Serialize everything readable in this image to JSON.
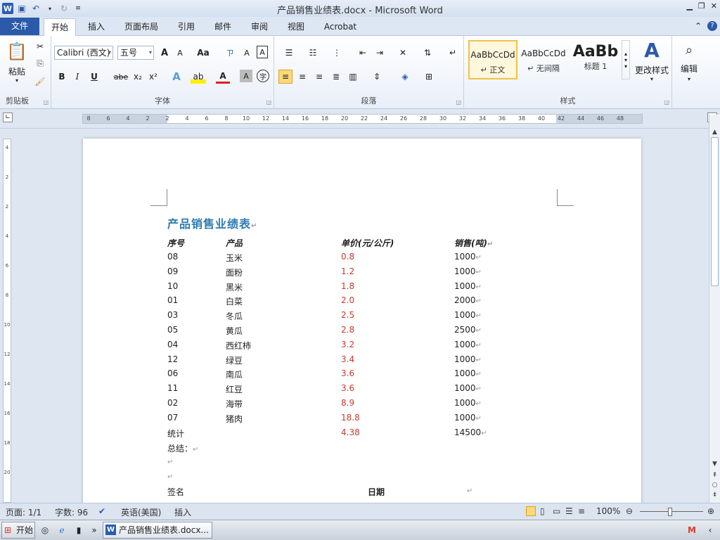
{
  "window": {
    "title": "产品销售业绩表.docx - Microsoft Word"
  },
  "tabs": [
    "文件",
    "开始",
    "插入",
    "页面布局",
    "引用",
    "邮件",
    "审阅",
    "视图",
    "Acrobat"
  ],
  "ribbon": {
    "clipboard": {
      "paste_label": "粘贴",
      "group_label": "剪贴板"
    },
    "font": {
      "font_name": "Calibri (西文)",
      "font_size": "五号",
      "group_label": "字体",
      "bold": "B",
      "italic": "I",
      "underline": "U",
      "strike": "abe",
      "sub": "x₂",
      "sup": "x²",
      "grow": "A",
      "shrink": "A",
      "case": "Aa",
      "clear_format": "A",
      "char_border": "A"
    },
    "paragraph": {
      "group_label": "段落"
    },
    "styles": {
      "group_label": "样式",
      "items": [
        {
          "preview": "AaBbCcDd",
          "name": "↵ 正文"
        },
        {
          "preview": "AaBbCcDd",
          "name": "↵ 无间隔"
        },
        {
          "preview": "AaBb",
          "name": "标题 1"
        }
      ],
      "change_styles": "更改样式"
    },
    "editing": {
      "label": "编辑"
    }
  },
  "ruler": {
    "ticks": [
      "8",
      "6",
      "4",
      "2",
      "2",
      "4",
      "6",
      "8",
      "10",
      "12",
      "14",
      "16",
      "18",
      "20",
      "22",
      "24",
      "26",
      "28",
      "30",
      "32",
      "34",
      "36",
      "38",
      "40",
      "42",
      "44",
      "46",
      "48"
    ],
    "vticks": [
      "4",
      "2",
      "2",
      "4",
      "6",
      "8",
      "10",
      "12",
      "14",
      "16",
      "18",
      "20"
    ]
  },
  "document": {
    "title": "产品销售业绩表",
    "headers": [
      "序号",
      "产品",
      "单价(元/公斤)",
      "销售(吨)"
    ],
    "rows": [
      [
        "08",
        "玉米",
        "0.8",
        "1000"
      ],
      [
        "09",
        "面粉",
        "1.2",
        "1000"
      ],
      [
        "10",
        "黑米",
        "1.8",
        "1000"
      ],
      [
        "01",
        "白菜",
        "2.0",
        "2000"
      ],
      [
        "03",
        "冬瓜",
        "2.5",
        "1000"
      ],
      [
        "05",
        "黄瓜",
        "2.8",
        "2500"
      ],
      [
        "04",
        "西红柿",
        "3.2",
        "1000"
      ],
      [
        "12",
        "绿豆",
        "3.4",
        "1000"
      ],
      [
        "06",
        "南瓜",
        "3.6",
        "1000"
      ],
      [
        "11",
        "红豆",
        "3.6",
        "1000"
      ],
      [
        "02",
        "海带",
        "8.9",
        "1000"
      ],
      [
        "07",
        "猪肉",
        "18.8",
        "1000"
      ]
    ],
    "total": {
      "label": "统计",
      "price": "4.38",
      "sales": "14500"
    },
    "summary": "总结：",
    "sign": "签名",
    "date": "日期",
    "pilcrow": "↵"
  },
  "statusbar": {
    "page": "页面: 1/1",
    "words": "字数: 96",
    "language": "英语(美国)",
    "insert": "插入",
    "zoom": "100%"
  },
  "taskbar": {
    "start": "开始",
    "task": "产品销售业绩表.docx...",
    "chevron": "»"
  },
  "colors": {
    "title": "#2e7bb0",
    "price": "#c83a2c",
    "file_tab": "#2b5aa8"
  }
}
